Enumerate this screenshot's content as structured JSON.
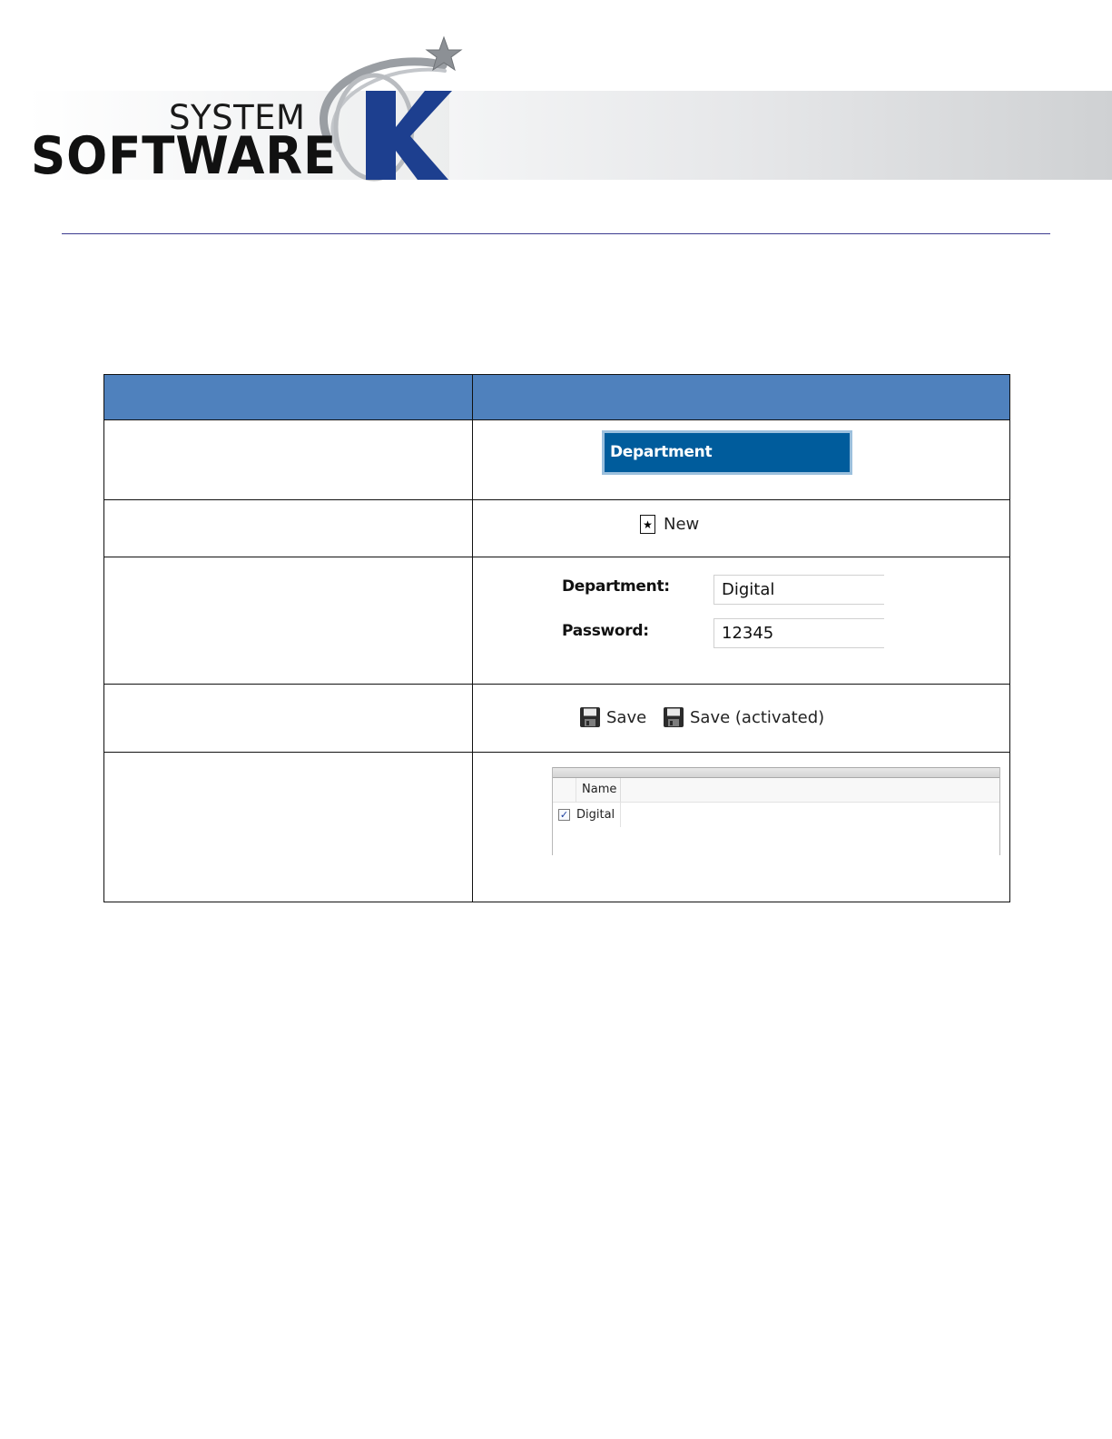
{
  "logo": {
    "line1": "SYSTEM",
    "line2": "SOFTWARE",
    "letter": "K"
  },
  "table": {
    "header": [
      "",
      ""
    ],
    "rows": [
      {
        "description": "",
        "department_tab": "Department"
      },
      {
        "description": "",
        "new_button": {
          "icon": "new-star-icon",
          "label": "New"
        }
      },
      {
        "description": "",
        "form": {
          "department_label": "Department:",
          "department_value": "Digital",
          "password_label": "Password:",
          "password_value": "12345"
        }
      },
      {
        "description": "",
        "save_buttons": [
          {
            "icon": "floppy-disk-icon",
            "label": "Save"
          },
          {
            "icon": "floppy-disk-icon",
            "label": "Save (activated)"
          }
        ]
      },
      {
        "description": "",
        "grid": {
          "columns": [
            "Name"
          ],
          "rows": [
            {
              "checked": true,
              "name": "Digital"
            }
          ]
        }
      }
    ]
  },
  "colors": {
    "table_header": "#4f81bd",
    "department_tab": "#005c9c",
    "logo_blue": "#1d3f8f",
    "rule": "#3c3a8f"
  }
}
